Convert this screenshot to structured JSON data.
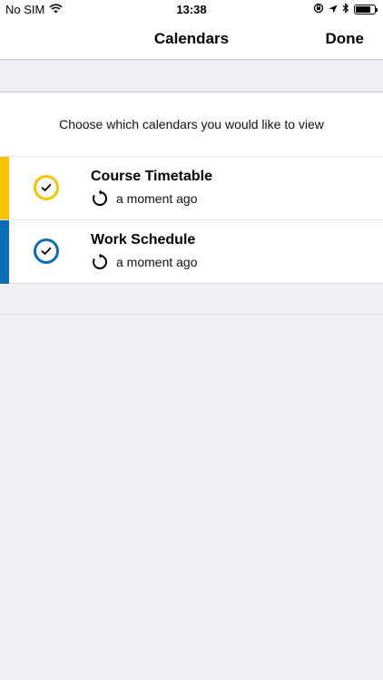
{
  "status_bar": {
    "carrier": "No SIM",
    "time": "13:38",
    "battery_level": 0.8
  },
  "nav": {
    "title": "Calendars",
    "done_label": "Done"
  },
  "instruction": "Choose which calendars you would like to view",
  "calendars": [
    {
      "name": "Course Timetable",
      "sync_text": "a moment ago",
      "color": "#f5c400",
      "selected": true
    },
    {
      "name": "Work Schedule",
      "sync_text": "a moment ago",
      "color": "#0a6eb4",
      "selected": true
    }
  ]
}
